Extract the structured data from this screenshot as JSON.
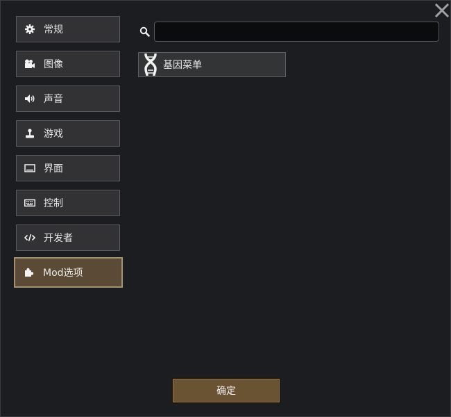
{
  "nav": {
    "items": [
      {
        "label": "常规",
        "icon": "gear-icon"
      },
      {
        "label": "图像",
        "icon": "camera-icon"
      },
      {
        "label": "声音",
        "icon": "speaker-icon"
      },
      {
        "label": "游戏",
        "icon": "joystick-icon"
      },
      {
        "label": "界面",
        "icon": "monitor-icon"
      },
      {
        "label": "控制",
        "icon": "keyboard-icon"
      },
      {
        "label": "开发者",
        "icon": "code-icon"
      },
      {
        "label": "Mod选项",
        "icon": "puzzle-icon"
      }
    ],
    "active_index": 7
  },
  "search": {
    "placeholder": "",
    "value": ""
  },
  "mods": [
    {
      "label": "基因菜单",
      "icon": "dna-icon"
    }
  ],
  "footer": {
    "ok_label": "确定"
  },
  "colors": {
    "background": "#1b1d21",
    "button": "#323234",
    "active": "#5b4b36",
    "active_border": "#a39272",
    "ok_button": "#6a5332"
  }
}
